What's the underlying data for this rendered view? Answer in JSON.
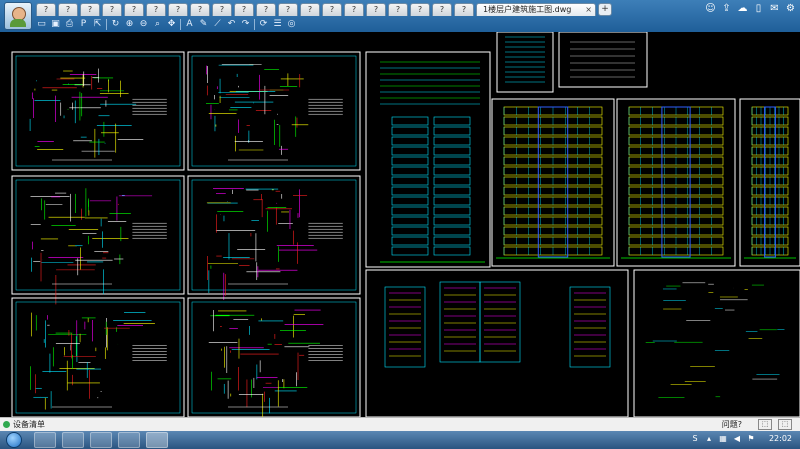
{
  "window": {
    "document_title": "1楼层户建筑施工图.dwg",
    "close_glyph": "×",
    "new_tab_glyph": "+"
  },
  "tabs": {
    "inactive_count": 20
  },
  "toolbar": {
    "icons": [
      "open-icon",
      "save-icon",
      "print-icon",
      "pdf-icon",
      "export-icon",
      "rotate-icon",
      "zoom-in-icon",
      "zoom-out-icon",
      "zoom-window-icon",
      "pan-icon",
      "text-icon",
      "pen-icon",
      "measure-icon",
      "undo-icon",
      "redo-icon",
      "rotate-view-icon",
      "layers-icon",
      "settings-icon"
    ]
  },
  "status": {
    "text": "设备清单",
    "feedback": "问题?",
    "btn1": "⬚",
    "btn2": "⬚"
  },
  "taskbar": {
    "time": "22:02"
  },
  "colors": {
    "titlebar": "#2a6aa8",
    "frame": "#ffffff",
    "cyan": "#00e5ff",
    "yellow": "#ffff00",
    "magenta": "#ff00ff",
    "green": "#00ff00",
    "red": "#ff2020",
    "blue": "#3060ff"
  }
}
